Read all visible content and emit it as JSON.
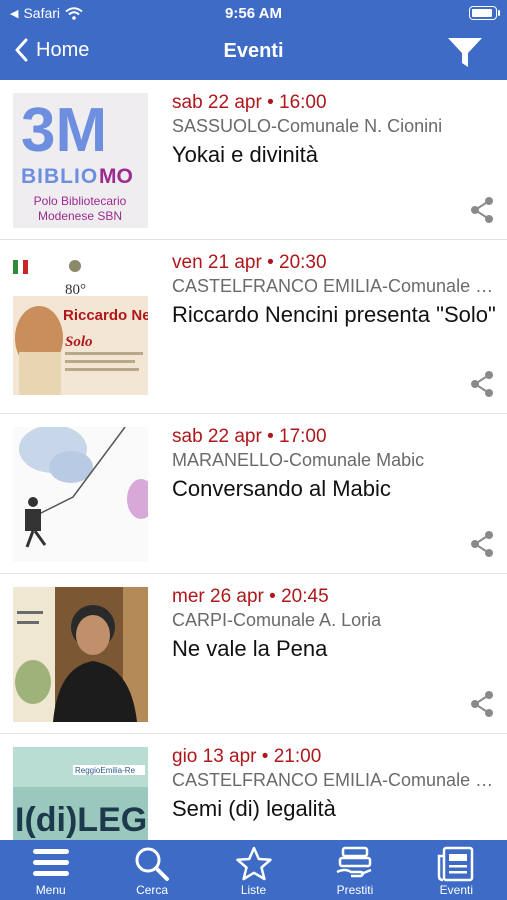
{
  "status_bar": {
    "carrier": "Safari",
    "time": "9:56 AM"
  },
  "nav": {
    "back_label": "Home",
    "title": "Eventi"
  },
  "events": [
    {
      "date": "sab 22 apr • 16:00",
      "place": "SASSUOLO-Comunale N. Cionini",
      "title": "Yokai e divinità"
    },
    {
      "date": "ven 21 apr • 20:30",
      "place": "CASTELFRANCO EMILIA-Comunale Lea Garofalo",
      "title": "Riccardo Nencini presenta \"Solo\""
    },
    {
      "date": "sab 22 apr • 17:00",
      "place": "MARANELLO-Comunale Mabic",
      "title": "Conversando al Mabic"
    },
    {
      "date": "mer 26 apr • 20:45",
      "place": "CARPI-Comunale A. Loria",
      "title": "Ne vale la Pena"
    },
    {
      "date": "gio 13 apr • 21:00",
      "place": "CASTELFRANCO EMILIA-Comunale Lea Garofalo",
      "title": "Semi (di) legalità"
    }
  ],
  "thumbs": {
    "bibliomo_top": "3M",
    "bibliomo_word": "BIBLIOMO",
    "bibliomo_caption_1": "Polo Bibliotecario",
    "bibliomo_caption_2": "Modenese SBN",
    "nencini_anniv": "80°",
    "nencini_name": "Riccardo Ne",
    "nencini_solo": "Solo",
    "legal_text": "I(di)LEGAI",
    "legal_reggio": "ReggioEmilia-Re"
  },
  "tabs": [
    {
      "label": "Menu",
      "icon": "menu-icon"
    },
    {
      "label": "Cerca",
      "icon": "search-icon"
    },
    {
      "label": "Liste",
      "icon": "star-icon"
    },
    {
      "label": "Prestiti",
      "icon": "loans-icon"
    },
    {
      "label": "Eventi",
      "icon": "news-icon"
    }
  ],
  "colors": {
    "bar": "#3d6bc6",
    "date": "#b0171b",
    "place": "#6a6a6a"
  }
}
